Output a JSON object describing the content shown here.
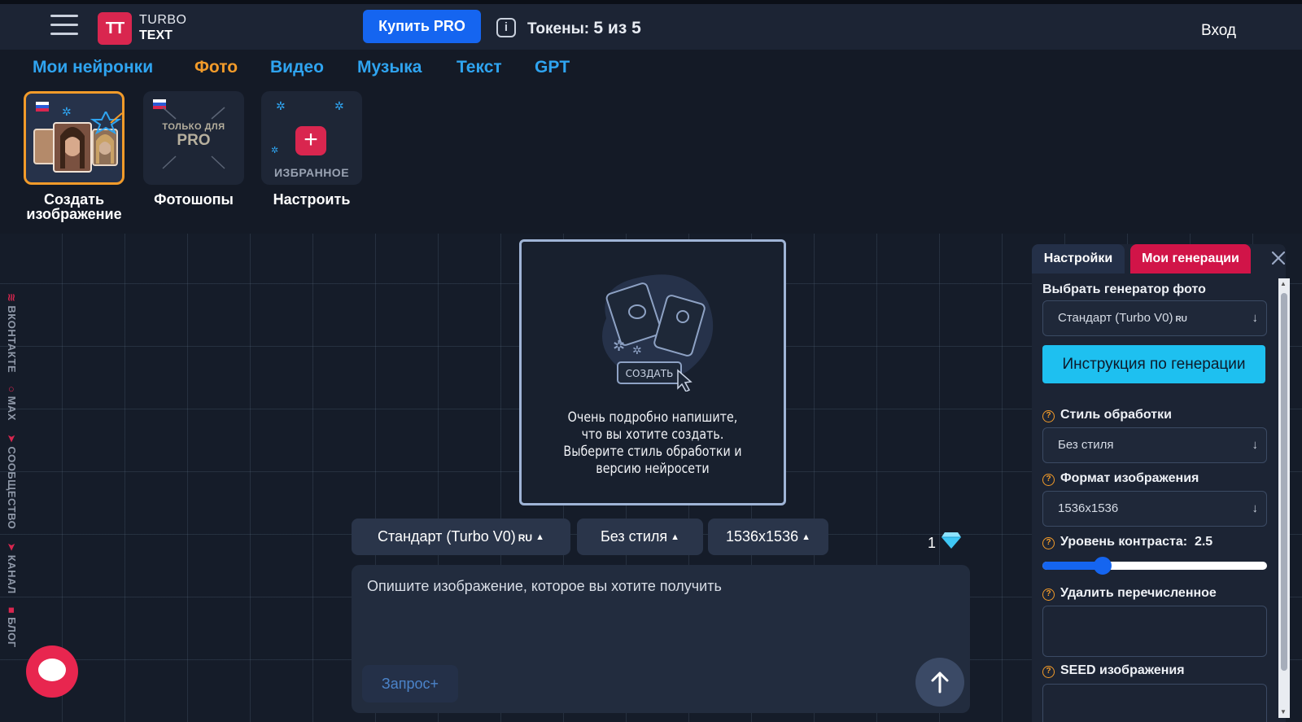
{
  "header": {
    "logo_mark": "TT",
    "logo_line1": "TURBO",
    "logo_line2": "TEXT",
    "buy_pro_label": "Купить PRO",
    "tokens_label": "Токены:",
    "tokens_value": "5 из 5",
    "login_label": "Вход"
  },
  "nav": {
    "tabs": [
      {
        "label": "Мои нейронки",
        "active": false
      },
      {
        "label": "Фото",
        "active": true
      },
      {
        "label": "Видео",
        "active": false
      },
      {
        "label": "Музыка",
        "active": false
      },
      {
        "label": "Текст",
        "active": false
      },
      {
        "label": "GPT",
        "active": false
      }
    ]
  },
  "cards": [
    {
      "label": "Создать изображение",
      "active": true
    },
    {
      "label": "Фотошопы",
      "badge_small": "ТОЛЬКО ДЛЯ",
      "badge_big": "PRO"
    },
    {
      "label": "Настроить",
      "badge": "ИЗБРАННОЕ",
      "icon": "plus-icon"
    }
  ],
  "side_links": [
    {
      "icon": "vk-icon",
      "label": "ВКОНТАКТЕ"
    },
    {
      "icon": "max-icon",
      "label": "MAX"
    },
    {
      "icon": "send-icon",
      "label": "СООБЩЕСТВО"
    },
    {
      "icon": "send-icon",
      "label": "КАНАЛ"
    },
    {
      "icon": "blog-icon",
      "label": "БЛОГ"
    }
  ],
  "hint": {
    "button_label": "СОЗДАТЬ",
    "text": "Очень подробно напишите, что вы хотите создать. Выберите стиль обработки и версию нейросети"
  },
  "chips": {
    "model": "Стандарт (Turbo V0)",
    "model_tag": "RU",
    "style": "Без стиля",
    "size": "1536x1536"
  },
  "cost": {
    "value": "1",
    "icon": "diamond-icon"
  },
  "prompt": {
    "placeholder": "Опишите изображение, которое вы хотите получить",
    "query_label": "Запрос+"
  },
  "panel": {
    "tab_settings": "Настройки",
    "tab_generations": "Мои генерации",
    "generator_label": "Выбрать генератор фото",
    "generator_value": "Стандарт (Turbo V0)",
    "generator_tag": "RU",
    "instruction_label": "Инструкция по генерации",
    "style_label": "Стиль обработки",
    "style_value": "Без стиля",
    "format_label": "Формат изображения",
    "format_value": "1536x1536",
    "contrast_label": "Уровень контраста:",
    "contrast_value": "2.5",
    "remove_label": "Удалить перечисленное",
    "seed_label": "SEED изображения"
  },
  "colors": {
    "accent_blue": "#1565f0",
    "accent_red": "#d11448",
    "accent_orange": "#f29b2a",
    "link_blue": "#2fa4f0",
    "cyan": "#1ec0f0"
  }
}
